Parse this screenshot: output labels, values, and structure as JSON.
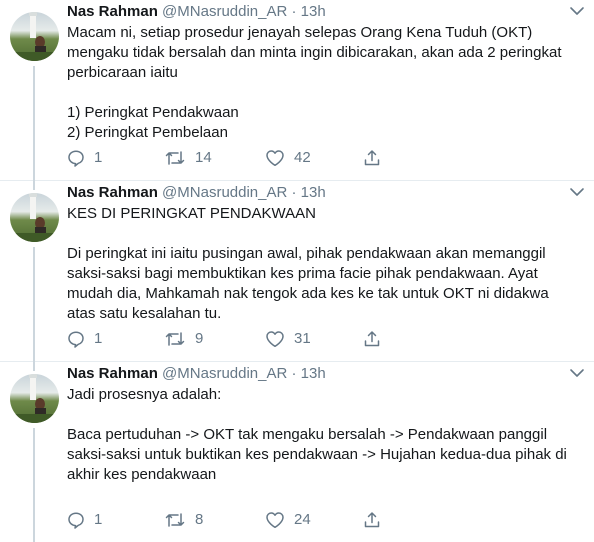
{
  "tweets": [
    {
      "author": {
        "name": "Nas Rahman",
        "handle": "@MNasruddin_AR"
      },
      "separator": "·",
      "time": "13h",
      "lines": [
        "Macam ni, setiap prosedur jenayah selepas Orang Kena Tuduh (OKT)",
        "mengaku tidak bersalah dan minta ingin dibicarakan, akan ada 2 peringkat",
        "perbicaraan iaitu",
        "1) Peringkat Pendakwaan",
        "2) Peringkat Pembelaan"
      ],
      "replies": "1",
      "retweets": "14",
      "likes": "42"
    },
    {
      "author": {
        "name": "Nas Rahman",
        "handle": "@MNasruddin_AR"
      },
      "separator": "·",
      "time": "13h",
      "lines": [
        "KES DI PERINGKAT PENDAKWAAN",
        "Di peringkat ini iaitu pusingan awal, pihak pendakwaan akan memanggil",
        "saksi-saksi bagi membuktikan kes prima facie pihak pendakwaan. Ayat",
        "mudah dia, Mahkamah nak tengok ada kes ke tak untuk OKT ni didakwa",
        "atas satu kesalahan tu."
      ],
      "replies": "1",
      "retweets": "9",
      "likes": "31"
    },
    {
      "author": {
        "name": "Nas Rahman",
        "handle": "@MNasruddin_AR"
      },
      "separator": "·",
      "time": "13h",
      "lines": [
        "Jadi prosesnya adalah:",
        "Baca pertuduhan -> OKT tak mengaku bersalah -> Pendakwaan panggil",
        "saksi-saksi untuk buktikan kes pendakwaan -> Hujahan kedua-dua pihak di",
        "akhir kes pendakwaan"
      ],
      "replies": "1",
      "retweets": "8",
      "likes": "24"
    }
  ],
  "icons": {
    "reply": "reply-icon",
    "retweet": "retweet-icon",
    "like": "like-icon",
    "share": "share-icon",
    "caret": "chevron-down-icon"
  },
  "colors": {
    "text": "#14171a",
    "secondary": "#657786",
    "thread_line": "#ccd6dd",
    "divider": "#e6ecf0"
  }
}
